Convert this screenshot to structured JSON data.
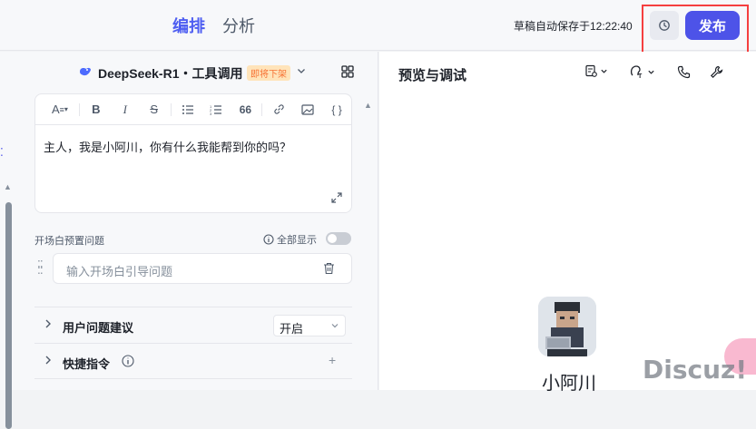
{
  "header": {
    "tab_edit": "编排",
    "tab_analyze": "分析",
    "draft_status": "草稿自动保存于12:22:40",
    "publish_label": "发布"
  },
  "model": {
    "name": "DeepSeek-R1・工具调用",
    "badge": "即将下架"
  },
  "editor": {
    "toolbar": [
      "A",
      "B",
      "I",
      "S",
      "•≡",
      "1≡",
      "66",
      "link",
      "image",
      "{ }"
    ],
    "text": "主人，我是小阿川，你有什么我能帮到你的吗？"
  },
  "opener": {
    "label": "开场白预置问题",
    "show_all": "全部显示",
    "show_all_on": false,
    "placeholder": "输入开场白引导问题"
  },
  "suggest": {
    "title": "用户问题建议",
    "value": "开启"
  },
  "shortcut": {
    "title": "快捷指令"
  },
  "preview": {
    "title": "预览与调试",
    "bot_name": "小阿川"
  },
  "watermark": "Discuz!",
  "colors": {
    "accent": "#4d53e8",
    "highlight_box": "#f53f3f"
  }
}
